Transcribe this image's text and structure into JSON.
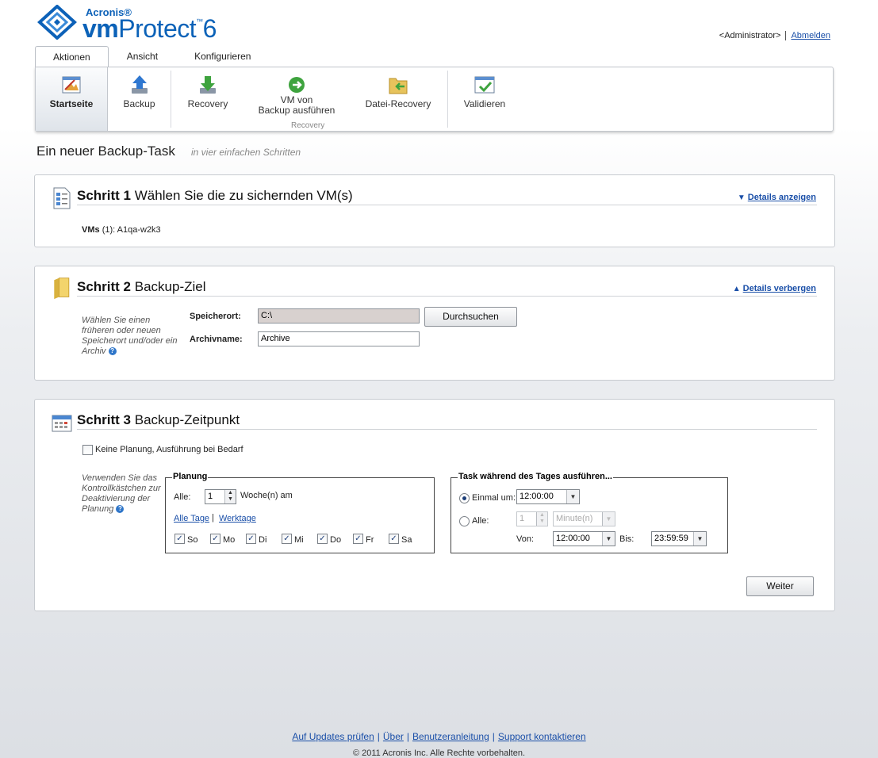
{
  "brand": {
    "company": "Acronis®",
    "product_bold": "vm",
    "product_rest": "Protect",
    "version": "6"
  },
  "user": {
    "name": "<Administrator>",
    "logout": "Abmelden"
  },
  "tabs": [
    {
      "label": "Aktionen",
      "active": true
    },
    {
      "label": "Ansicht",
      "active": false
    },
    {
      "label": "Konfigurieren",
      "active": false
    }
  ],
  "ribbon": {
    "home": "Startseite",
    "backup": "Backup",
    "recovery": "Recovery",
    "run_vm_line1": "VM von",
    "run_vm_line2": "Backup ausführen",
    "file_recovery": "Datei-Recovery",
    "group_recovery": "Recovery",
    "validate": "Validieren"
  },
  "page": {
    "title": "Ein neuer Backup-Task",
    "subtitle": "in vier einfachen Schritten"
  },
  "step1": {
    "label": "Schritt 1",
    "title": "Wählen Sie die zu sichernden VM(s)",
    "toggle": "Details anzeigen",
    "vms_label": "VMs",
    "vms_count": "(1):",
    "vms_value": "A1qa-w2k3"
  },
  "step2": {
    "label": "Schritt 2",
    "title": "Backup-Ziel",
    "toggle": "Details verbergen",
    "hint_l1": "Wählen Sie einen",
    "hint_l2": "früheren oder neuen",
    "hint_l3": "Speicherort und/oder ein",
    "hint_l4": "Archiv",
    "location_label": "Speicherort:",
    "location_value": "C:\\",
    "browse": "Durchsuchen",
    "archive_label": "Archivname:",
    "archive_value": "Archive"
  },
  "step3": {
    "label": "Schritt 3",
    "title": "Backup-Zeitpunkt",
    "no_schedule": "Keine Planung, Ausführung bei Bedarf",
    "hint_l1": "Verwenden Sie das",
    "hint_l2": "Kontrollkästchen zur",
    "hint_l3": "Deaktivierung der",
    "hint_l4": "Planung",
    "planning": {
      "title": "Planung",
      "every_label": "Alle:",
      "every_value": "1",
      "every_unit": "Woche(n) am",
      "all_days": "Alle Tage",
      "workdays": "Werktage",
      "days": [
        "So",
        "Mo",
        "Di",
        "Mi",
        "Do",
        "Fr",
        "Sa"
      ]
    },
    "daytime": {
      "title": "Task während des Tages ausführen...",
      "once_label": "Einmal um:",
      "once_value": "12:00:00",
      "every_label": "Alle:",
      "every_value": "1",
      "every_unit": "Minute(n)",
      "from_label": "Von:",
      "from_value": "12:00:00",
      "to_label": "Bis:",
      "to_value": "23:59:59"
    },
    "next": "Weiter"
  },
  "footer": {
    "updates": "Auf Updates prüfen",
    "about": "Über",
    "manual": "Benutzeranleitung",
    "support": "Support kontaktieren",
    "copyright": "© 2011 Acronis Inc. Alle Rechte vorbehalten."
  }
}
